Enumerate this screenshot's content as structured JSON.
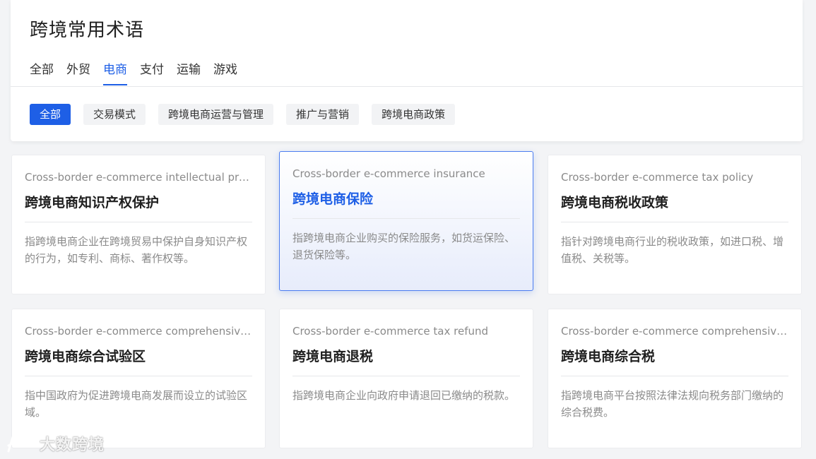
{
  "header": {
    "title": "跨境常用术语"
  },
  "tabs": [
    "全部",
    "外贸",
    "电商",
    "支付",
    "运输",
    "游戏"
  ],
  "active_tab": "电商",
  "filters": [
    "全部",
    "交易模式",
    "跨境电商运营与管理",
    "推广与营销",
    "跨境电商政策"
  ],
  "active_filter": "全部",
  "cards": [
    {
      "en": "Cross-border e-commerce intellectual prope...",
      "zh": "跨境电商知识产权保护",
      "desc": "指跨境电商企业在跨境贸易中保护自身知识产权的行为，如专利、商标、著作权等。"
    },
    {
      "en": "Cross-border e-commerce insurance",
      "zh": "跨境电商保险",
      "desc": "指跨境电商企业购买的保险服务，如货运保险、退货保险等。"
    },
    {
      "en": "Cross-border e-commerce tax policy",
      "zh": "跨境电商税收政策",
      "desc": "指针对跨境电商行业的税收政策，如进口税、增值税、关税等。"
    },
    {
      "en": "Cross-border e-commerce comprehensive te...",
      "zh": "跨境电商综合试验区",
      "desc": "指中国政府为促进跨境电商发展而设立的试验区域。"
    },
    {
      "en": "Cross-border e-commerce tax refund",
      "zh": "跨境电商退税",
      "desc": "指跨境电商企业向政府申请退回已缴纳的税款。"
    },
    {
      "en": "Cross-border e-commerce comprehensive tax",
      "zh": "跨境电商综合税",
      "desc": "指跨境电商平台按照法律法规向税务部门缴纳的综合税费。"
    }
  ],
  "watermark": {
    "text": "大数跨境"
  },
  "colors": {
    "accent": "#1e5fe6",
    "text": "#1f1f1f",
    "muted": "#8a8a8a"
  }
}
